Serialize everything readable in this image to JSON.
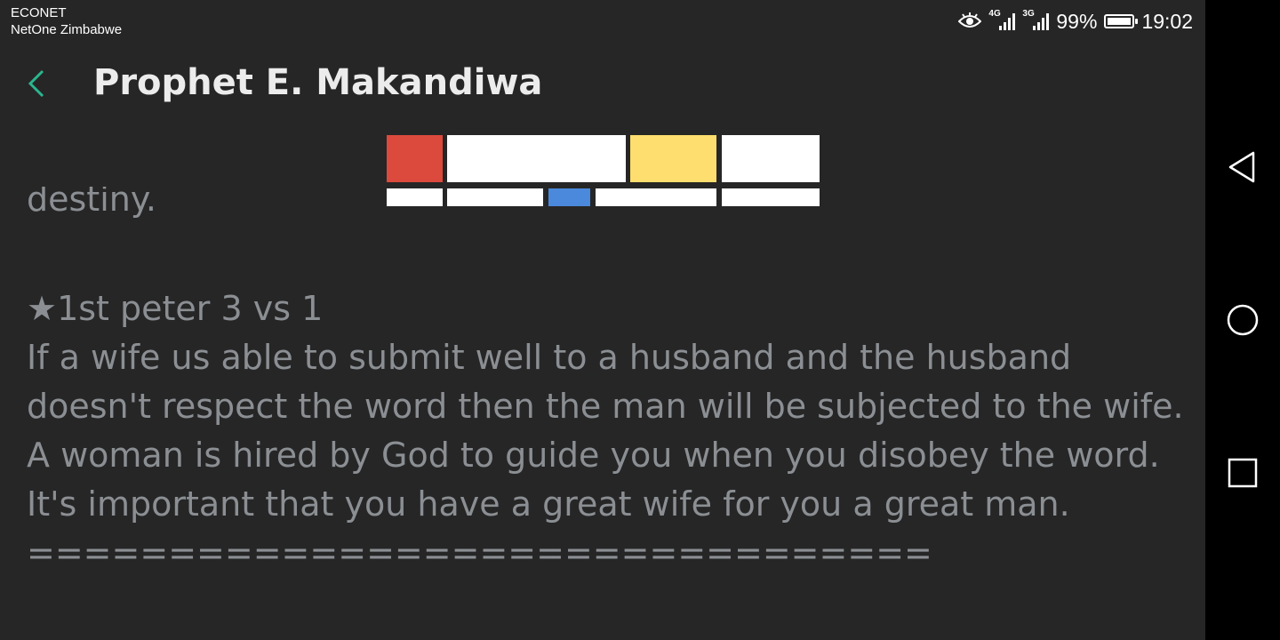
{
  "status_bar": {
    "carrier_primary": "ECONET",
    "carrier_secondary": "NetOne Zimbabwe",
    "network_1": "4G",
    "network_2": "3G",
    "battery": "99%",
    "battery_level": 0.99,
    "time": "19:02"
  },
  "app_bar": {
    "title": "Prophet E. Makandiwa"
  },
  "banner": {
    "colors": {
      "red": "#dc4a3d",
      "yellow": "#fede6e",
      "blue": "#4a89dc",
      "white": "#ffffff"
    }
  },
  "content": {
    "clipped_text": "destiny.",
    "verse_ref": "★1st peter 3 vs 1",
    "lines": [
      "If a wife us able to submit well to a husband and the husband",
      "doesn't respect the word then the man will be subjected to the wife.",
      "A woman is hired by God to guide you when you disobey the word.",
      "It's important that you have a great wife for you a great man."
    ],
    "divider": "================================"
  },
  "colors": {
    "background": "#262626",
    "text": "#8b8f93",
    "title": "#ececec",
    "accent": "#2bb58e"
  }
}
